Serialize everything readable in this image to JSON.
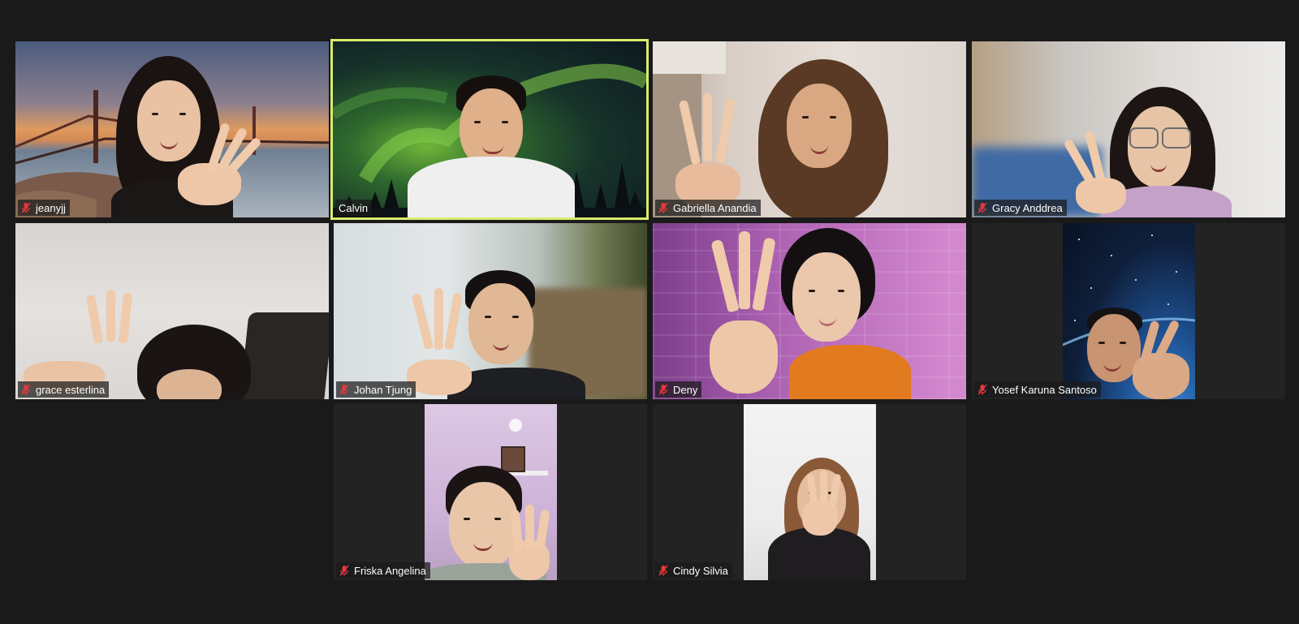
{
  "meeting": {
    "view": "Gallery View",
    "active_speaker": "Calvin",
    "highlight_color": "#d7ec6a",
    "muted_icon_color": "#e5383b"
  },
  "participants": [
    {
      "name": "jeanyjj",
      "muted": true,
      "background": "Golden Gate sunset"
    },
    {
      "name": "Calvin",
      "muted": false,
      "background": "Aurora night sky"
    },
    {
      "name": "Gabriella Anandia",
      "muted": true,
      "background": "room"
    },
    {
      "name": "Gracy Anddrea",
      "muted": true,
      "background": "blurred room"
    },
    {
      "name": "grace esterlina",
      "muted": true,
      "background": "room"
    },
    {
      "name": "Johan Tjung",
      "muted": true,
      "background": "blurred room"
    },
    {
      "name": "Deny",
      "muted": true,
      "background": "purple brick wall"
    },
    {
      "name": "Yosef Karuna Santoso",
      "muted": true,
      "background": "Earth from space"
    },
    {
      "name": "Friska Angelina",
      "muted": true,
      "background": "pink room"
    },
    {
      "name": "Cindy Silvia",
      "muted": true,
      "background": "white wall"
    }
  ],
  "icons": {
    "muted_mic": "muted-microphone-icon"
  }
}
